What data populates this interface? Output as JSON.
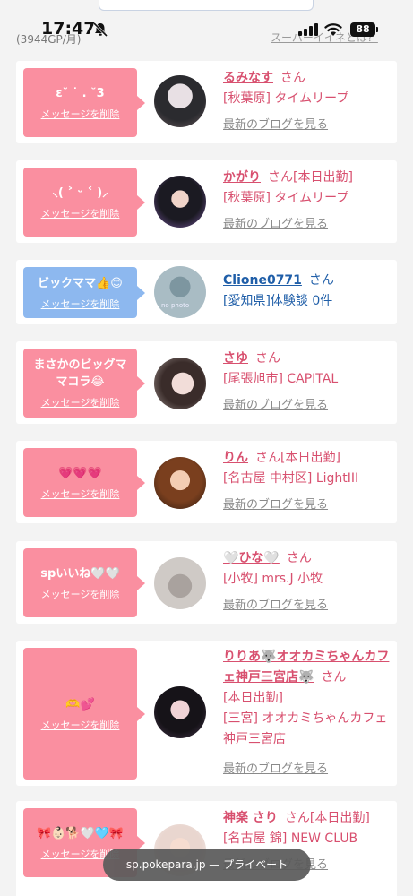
{
  "status_bar": {
    "time": "17:47",
    "battery": "88",
    "under_left": "(3944GP/月)",
    "under_right": "スーパーイイネとは？"
  },
  "cards": [
    {
      "message": "ε˘ ˙ . ˘3",
      "delete_label": "メッセージを削除",
      "name": "るみなす",
      "san": "さん",
      "extra": "",
      "shop": "[秋葉原] タイムリープ",
      "blog": "最新のブログを見る",
      "bubble_color": "#fa8fa0"
    },
    {
      "message": "⸜( ˃ ᵕ ˂ )⸝",
      "delete_label": "メッセージを削除",
      "name": "かがり",
      "san": "さん",
      "extra": "[本日出勤]",
      "shop": "[秋葉原] タイムリープ",
      "blog": "最新のブログを見る",
      "bubble_color": "#fa8fa0"
    },
    {
      "message": "ビックママ👍😊",
      "delete_label": "メッセージを削除",
      "name": "Clione0771",
      "san": "さん",
      "extra": "",
      "shop": "[愛知県]体験談 0件",
      "avatar_text": "no photo",
      "bubble_color": "#8db8ef"
    },
    {
      "message": "まさかのビッグママコラ😂",
      "delete_label": "メッセージを削除",
      "name": "さゆ",
      "san": "さん",
      "extra": "",
      "shop": "[尾張旭市] CAPITAL",
      "blog": "最新のブログを見る",
      "bubble_color": "#fa8fa0"
    },
    {
      "message": "💗💗💗",
      "delete_label": "メッセージを削除",
      "name": "りん",
      "san": "さん",
      "extra": "[本日出勤]",
      "shop": "[名古屋 中村区] LightIII",
      "blog": "最新のブログを見る",
      "bubble_color": "#fa8fa0"
    },
    {
      "message": "spいいね🤍🤍",
      "delete_label": "メッセージを削除",
      "name": "🤍ひな🤍",
      "san": "さん",
      "extra": "",
      "shop": "[小牧] mrs.J 小牧",
      "blog": "最新のブログを見る",
      "bubble_color": "#fa8fa0"
    },
    {
      "message": "🫶💕",
      "delete_label": "メッセージを削除",
      "name": "りりあ🐺オオカミちゃんカフェ神戸三宮店🐺",
      "san": "さん",
      "extra": "[本日出勤]",
      "shop": "[三宮] オオカミちゃんカフェ神戸三宮店",
      "blog": "最新のブログを見る",
      "bubble_color": "#fa8fa0"
    },
    {
      "message": "🎀👶🏻🐕🤍🩵🎀",
      "delete_label": "メッセージを削除",
      "name": "神楽 さり",
      "san": "さん",
      "extra": "[本日出勤]",
      "shop": "[名古屋 錦] NEW CLUB",
      "blog": "最新のブログを見る",
      "bubble_color": "#fa8fa0"
    }
  ],
  "url_bar": {
    "text": "sp.pokepara.jp — プライベート"
  }
}
